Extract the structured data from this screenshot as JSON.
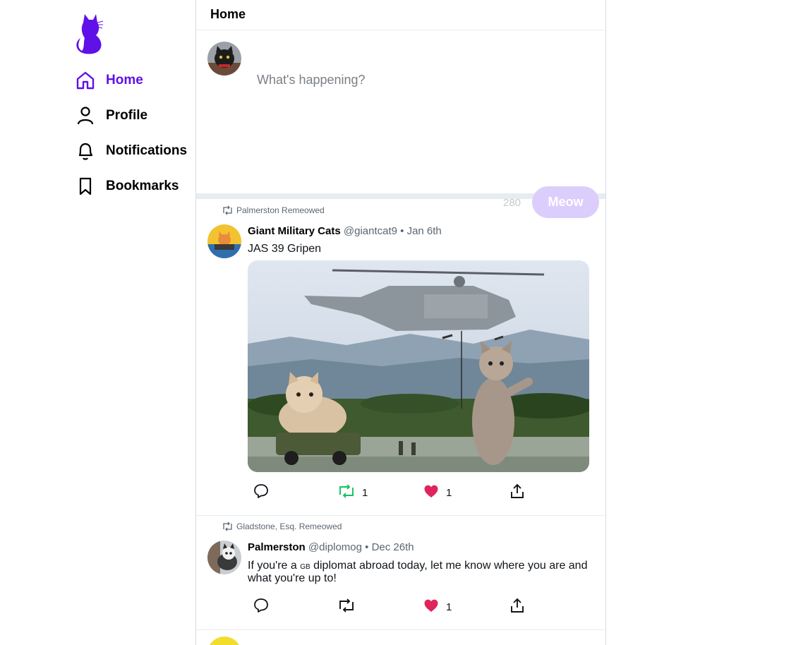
{
  "sidebar": {
    "logo_icon": "cat-logo",
    "items": [
      {
        "label": "Home",
        "icon": "home-icon",
        "active": true
      },
      {
        "label": "Profile",
        "icon": "user-icon",
        "active": false
      },
      {
        "label": "Notifications",
        "icon": "bell-icon",
        "active": false
      },
      {
        "label": "Bookmarks",
        "icon": "bookmark-icon",
        "active": false
      }
    ]
  },
  "header": {
    "title": "Home"
  },
  "composer": {
    "placeholder": "What's happening?",
    "value": "",
    "counter": "280",
    "submit_label": "Meow"
  },
  "feed": [
    {
      "remeow_by": "Palmerston Remeowed",
      "name": "Giant Military Cats",
      "handle": "@giantcat9",
      "date": "• Jan 6th",
      "text": "JAS 39 Gripen",
      "has_image": true,
      "remeow_count": "1",
      "like_count": "1",
      "remeowed": true,
      "liked": true
    },
    {
      "remeow_by": "Gladstone, Esq. Remeowed",
      "name": "Palmerston",
      "handle": "@diplomog",
      "date": "• Dec 26th",
      "text_before": "If you're a ",
      "text_small": "GB",
      "text_after": " diplomat abroad today, let me know where you are and what you're up to!",
      "has_image": false,
      "remeow_count": "",
      "like_count": "1",
      "remeowed": false,
      "liked": true
    }
  ],
  "colors": {
    "brand": "#5f11e8",
    "like": "#e0245e",
    "remeow": "#17bf63",
    "button_disabled": "#dccefc"
  }
}
